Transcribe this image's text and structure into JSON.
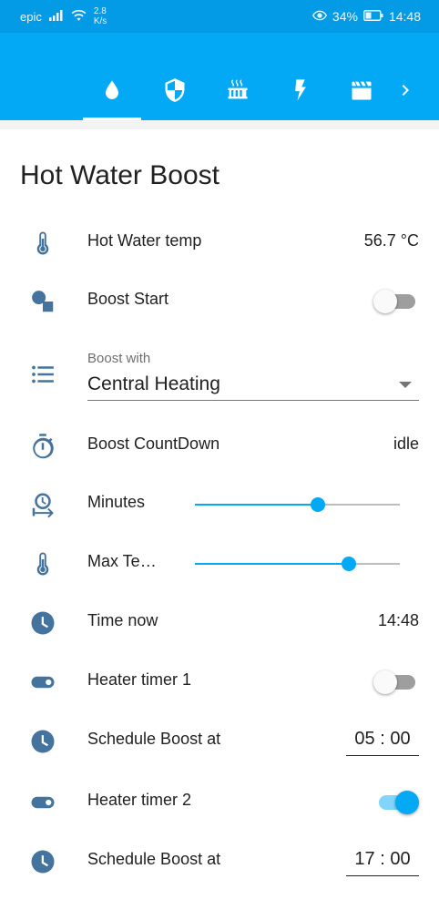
{
  "status_bar": {
    "carrier": "epic",
    "speed_value": "2.8",
    "speed_unit": "K/s",
    "battery": "34%",
    "time": "14:48"
  },
  "tabs": [
    {
      "icon": "water-drop-icon",
      "active": true
    },
    {
      "icon": "shield-icon",
      "active": false
    },
    {
      "icon": "radiator-icon",
      "active": false
    },
    {
      "icon": "lightning-icon",
      "active": false
    },
    {
      "icon": "clapperboard-icon",
      "active": false
    },
    {
      "icon": "chevron-right-icon",
      "active": false
    }
  ],
  "card": {
    "title": "Hot Water Boost",
    "rows": {
      "hot_water_temp": {
        "label": "Hot Water temp",
        "value": "56.7 °C",
        "icon": "thermometer-icon"
      },
      "boost_start": {
        "label": "Boost Start",
        "toggle": false,
        "icon": "shapes-icon"
      },
      "boost_with": {
        "label": "Boost with",
        "value": "Central Heating",
        "icon": "list-icon"
      },
      "boost_countdown": {
        "label": "Boost CountDown",
        "value": "idle",
        "icon": "timer-icon"
      },
      "minutes": {
        "label": "Minutes",
        "slider_fraction": 0.6,
        "icon": "clock-arrow-icon"
      },
      "max_temp": {
        "label": "Max Te…",
        "slider_fraction": 0.75,
        "icon": "thermometer-icon"
      },
      "time_now": {
        "label": "Time now",
        "value": "14:48",
        "icon": "clock-icon"
      },
      "heater_timer_1": {
        "label": "Heater timer 1",
        "toggle": false,
        "icon": "toggle-icon"
      },
      "schedule_boost_1": {
        "label": "Schedule Boost at",
        "value": "05 : 00",
        "icon": "clock-icon"
      },
      "heater_timer_2": {
        "label": "Heater timer 2",
        "toggle": true,
        "icon": "toggle-icon"
      },
      "schedule_boost_2": {
        "label": "Schedule Boost at",
        "value": "17 : 00",
        "icon": "clock-icon"
      }
    }
  },
  "colors": {
    "status_bar": "#039be5",
    "header": "#03a9f4",
    "accent": "#03a9f4",
    "icon": "#44739e"
  }
}
